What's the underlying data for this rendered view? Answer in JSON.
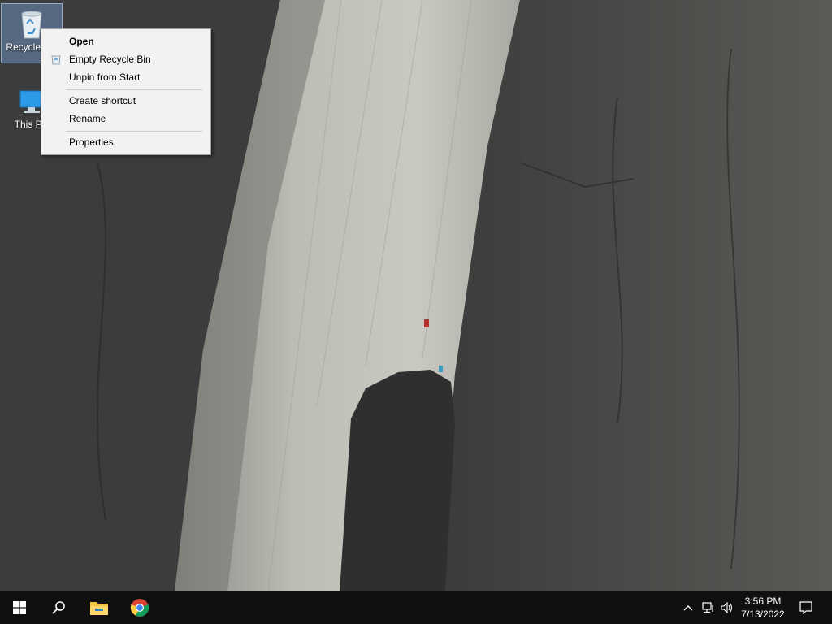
{
  "desktop": {
    "icons": [
      {
        "label": "Recycle Bin",
        "icon": "recycle-bin-icon"
      },
      {
        "label": "This PC",
        "icon": "computer-icon"
      }
    ]
  },
  "context_menu": {
    "items": [
      {
        "label": "Open",
        "bold": true
      },
      {
        "label": "Empty Recycle Bin",
        "icon": "recycle-bin-small-icon"
      },
      {
        "label": "Unpin from Start"
      },
      {
        "label": "Create shortcut"
      },
      {
        "label": "Rename"
      },
      {
        "label": "Properties"
      }
    ]
  },
  "taskbar": {
    "start": "windows-logo-icon",
    "search": "search-icon",
    "pinned": [
      "file-explorer-icon",
      "chrome-icon"
    ],
    "tray_icons": [
      "chevron-up-icon",
      "network-icon",
      "volume-icon"
    ],
    "clock": {
      "time": "3:56 PM",
      "date": "7/13/2022"
    },
    "notifications": "action-center-icon"
  },
  "colors": {
    "taskbar_bg": "#101010",
    "menu_bg": "#f2f2f2",
    "selection": "#7aa0d2"
  }
}
